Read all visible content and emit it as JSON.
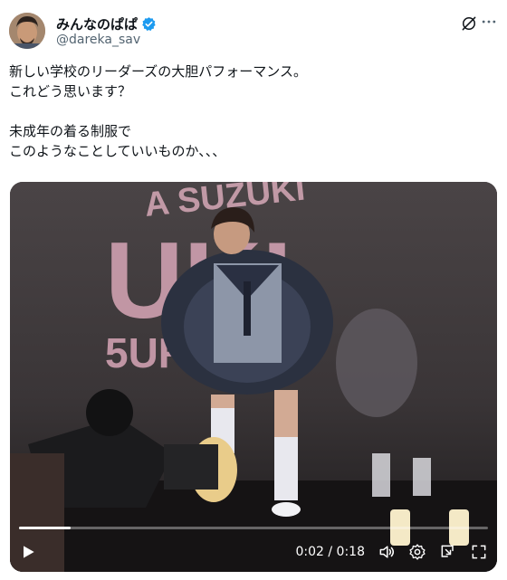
{
  "author": {
    "display_name": "みんなのぱぱ",
    "handle": "@dareka_sav",
    "verified": true
  },
  "post": {
    "text": "新しい学校のリーダーズの大胆パフォーマンス。\nこれどう思います？\n\n未成年の着る制服で\nこのようなことしていいものか、、、"
  },
  "video": {
    "time_display": "0:02 / 0:18",
    "progress": 0.11,
    "backdrop_text": [
      "A SUZUKI",
      "UKI",
      "5UR  GO!!"
    ]
  },
  "icons": {
    "grok": "grok-icon",
    "more": "more-icon",
    "play": "play-icon",
    "volume": "volume-icon",
    "settings": "gear-icon",
    "pip": "pip-icon",
    "fullscreen": "fullscreen-icon"
  },
  "colors": {
    "verified": "#1d9bf0",
    "text_primary": "#0f1419",
    "text_secondary": "#536471"
  }
}
